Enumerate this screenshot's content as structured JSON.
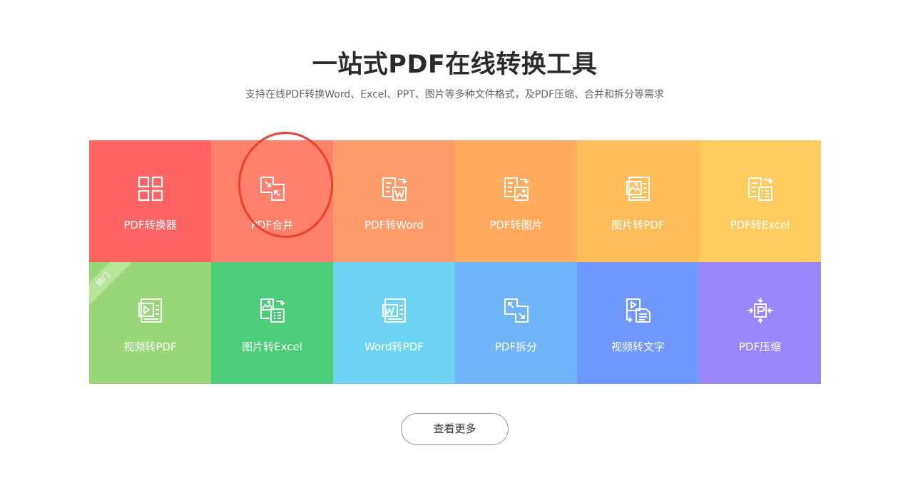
{
  "header": {
    "title": "一站式PDF在线转换工具",
    "subtitle": "支持在线PDF转换Word、Excel、PPT、图片等多种文件格式，及PDF压缩、合并和拆分等需求"
  },
  "tools": [
    {
      "label": "PDF转换器",
      "icon": "grid-icon",
      "color": "#ff6464"
    },
    {
      "label": "PDF合并",
      "icon": "merge-arrows-icon",
      "color": "#ff816b"
    },
    {
      "label": "PDF转Word",
      "icon": "pdf-to-word-icon",
      "color": "#ff9a6b"
    },
    {
      "label": "PDF转图片",
      "icon": "pdf-to-image-icon",
      "color": "#ffaa5c"
    },
    {
      "label": "图片转PDF",
      "icon": "image-to-pdf-icon",
      "color": "#ffbe5c"
    },
    {
      "label": "PDF转Excel",
      "icon": "pdf-to-excel-icon",
      "color": "#ffcd5f"
    },
    {
      "label": "视频转PDF",
      "icon": "video-to-pdf-icon",
      "color": "#98d878",
      "badge": "热门"
    },
    {
      "label": "图片转Excel",
      "icon": "image-to-excel-icon",
      "color": "#4ccd78"
    },
    {
      "label": "Word转PDF",
      "icon": "word-to-pdf-icon",
      "color": "#6fd4f3"
    },
    {
      "label": "PDF拆分",
      "icon": "split-arrows-icon",
      "color": "#6fb5f7"
    },
    {
      "label": "视频转文字",
      "icon": "video-to-text-icon",
      "color": "#7099ff"
    },
    {
      "label": "PDF压缩",
      "icon": "compress-icon",
      "color": "#9b85fc"
    }
  ],
  "more_button": {
    "label": "查看更多"
  },
  "highlight": {
    "color": "#e8412d",
    "target": "PDF合并"
  }
}
